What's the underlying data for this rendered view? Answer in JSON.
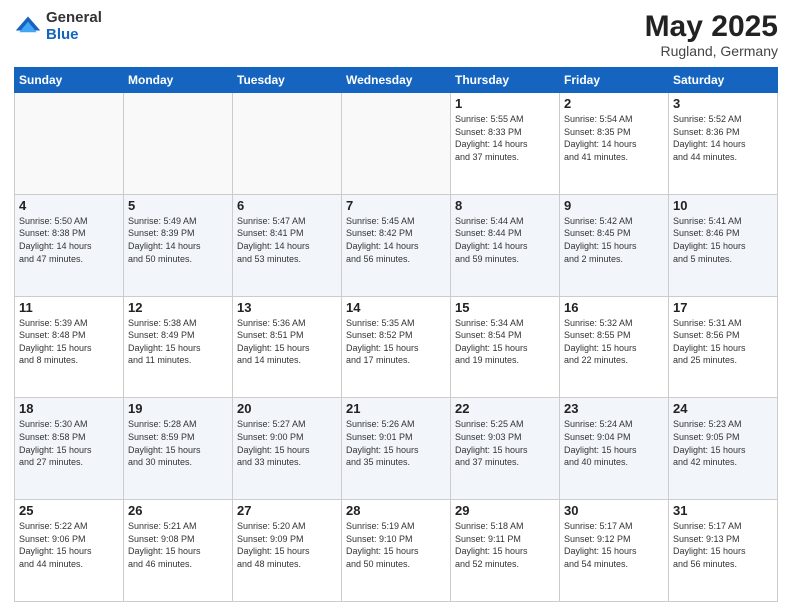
{
  "logo": {
    "general": "General",
    "blue": "Blue"
  },
  "header": {
    "month_year": "May 2025",
    "location": "Rugland, Germany"
  },
  "days_of_week": [
    "Sunday",
    "Monday",
    "Tuesday",
    "Wednesday",
    "Thursday",
    "Friday",
    "Saturday"
  ],
  "weeks": [
    [
      {
        "day": "",
        "text": ""
      },
      {
        "day": "",
        "text": ""
      },
      {
        "day": "",
        "text": ""
      },
      {
        "day": "",
        "text": ""
      },
      {
        "day": "1",
        "text": "Sunrise: 5:55 AM\nSunset: 8:33 PM\nDaylight: 14 hours\nand 37 minutes."
      },
      {
        "day": "2",
        "text": "Sunrise: 5:54 AM\nSunset: 8:35 PM\nDaylight: 14 hours\nand 41 minutes."
      },
      {
        "day": "3",
        "text": "Sunrise: 5:52 AM\nSunset: 8:36 PM\nDaylight: 14 hours\nand 44 minutes."
      }
    ],
    [
      {
        "day": "4",
        "text": "Sunrise: 5:50 AM\nSunset: 8:38 PM\nDaylight: 14 hours\nand 47 minutes."
      },
      {
        "day": "5",
        "text": "Sunrise: 5:49 AM\nSunset: 8:39 PM\nDaylight: 14 hours\nand 50 minutes."
      },
      {
        "day": "6",
        "text": "Sunrise: 5:47 AM\nSunset: 8:41 PM\nDaylight: 14 hours\nand 53 minutes."
      },
      {
        "day": "7",
        "text": "Sunrise: 5:45 AM\nSunset: 8:42 PM\nDaylight: 14 hours\nand 56 minutes."
      },
      {
        "day": "8",
        "text": "Sunrise: 5:44 AM\nSunset: 8:44 PM\nDaylight: 14 hours\nand 59 minutes."
      },
      {
        "day": "9",
        "text": "Sunrise: 5:42 AM\nSunset: 8:45 PM\nDaylight: 15 hours\nand 2 minutes."
      },
      {
        "day": "10",
        "text": "Sunrise: 5:41 AM\nSunset: 8:46 PM\nDaylight: 15 hours\nand 5 minutes."
      }
    ],
    [
      {
        "day": "11",
        "text": "Sunrise: 5:39 AM\nSunset: 8:48 PM\nDaylight: 15 hours\nand 8 minutes."
      },
      {
        "day": "12",
        "text": "Sunrise: 5:38 AM\nSunset: 8:49 PM\nDaylight: 15 hours\nand 11 minutes."
      },
      {
        "day": "13",
        "text": "Sunrise: 5:36 AM\nSunset: 8:51 PM\nDaylight: 15 hours\nand 14 minutes."
      },
      {
        "day": "14",
        "text": "Sunrise: 5:35 AM\nSunset: 8:52 PM\nDaylight: 15 hours\nand 17 minutes."
      },
      {
        "day": "15",
        "text": "Sunrise: 5:34 AM\nSunset: 8:54 PM\nDaylight: 15 hours\nand 19 minutes."
      },
      {
        "day": "16",
        "text": "Sunrise: 5:32 AM\nSunset: 8:55 PM\nDaylight: 15 hours\nand 22 minutes."
      },
      {
        "day": "17",
        "text": "Sunrise: 5:31 AM\nSunset: 8:56 PM\nDaylight: 15 hours\nand 25 minutes."
      }
    ],
    [
      {
        "day": "18",
        "text": "Sunrise: 5:30 AM\nSunset: 8:58 PM\nDaylight: 15 hours\nand 27 minutes."
      },
      {
        "day": "19",
        "text": "Sunrise: 5:28 AM\nSunset: 8:59 PM\nDaylight: 15 hours\nand 30 minutes."
      },
      {
        "day": "20",
        "text": "Sunrise: 5:27 AM\nSunset: 9:00 PM\nDaylight: 15 hours\nand 33 minutes."
      },
      {
        "day": "21",
        "text": "Sunrise: 5:26 AM\nSunset: 9:01 PM\nDaylight: 15 hours\nand 35 minutes."
      },
      {
        "day": "22",
        "text": "Sunrise: 5:25 AM\nSunset: 9:03 PM\nDaylight: 15 hours\nand 37 minutes."
      },
      {
        "day": "23",
        "text": "Sunrise: 5:24 AM\nSunset: 9:04 PM\nDaylight: 15 hours\nand 40 minutes."
      },
      {
        "day": "24",
        "text": "Sunrise: 5:23 AM\nSunset: 9:05 PM\nDaylight: 15 hours\nand 42 minutes."
      }
    ],
    [
      {
        "day": "25",
        "text": "Sunrise: 5:22 AM\nSunset: 9:06 PM\nDaylight: 15 hours\nand 44 minutes."
      },
      {
        "day": "26",
        "text": "Sunrise: 5:21 AM\nSunset: 9:08 PM\nDaylight: 15 hours\nand 46 minutes."
      },
      {
        "day": "27",
        "text": "Sunrise: 5:20 AM\nSunset: 9:09 PM\nDaylight: 15 hours\nand 48 minutes."
      },
      {
        "day": "28",
        "text": "Sunrise: 5:19 AM\nSunset: 9:10 PM\nDaylight: 15 hours\nand 50 minutes."
      },
      {
        "day": "29",
        "text": "Sunrise: 5:18 AM\nSunset: 9:11 PM\nDaylight: 15 hours\nand 52 minutes."
      },
      {
        "day": "30",
        "text": "Sunrise: 5:17 AM\nSunset: 9:12 PM\nDaylight: 15 hours\nand 54 minutes."
      },
      {
        "day": "31",
        "text": "Sunrise: 5:17 AM\nSunset: 9:13 PM\nDaylight: 15 hours\nand 56 minutes."
      }
    ]
  ]
}
